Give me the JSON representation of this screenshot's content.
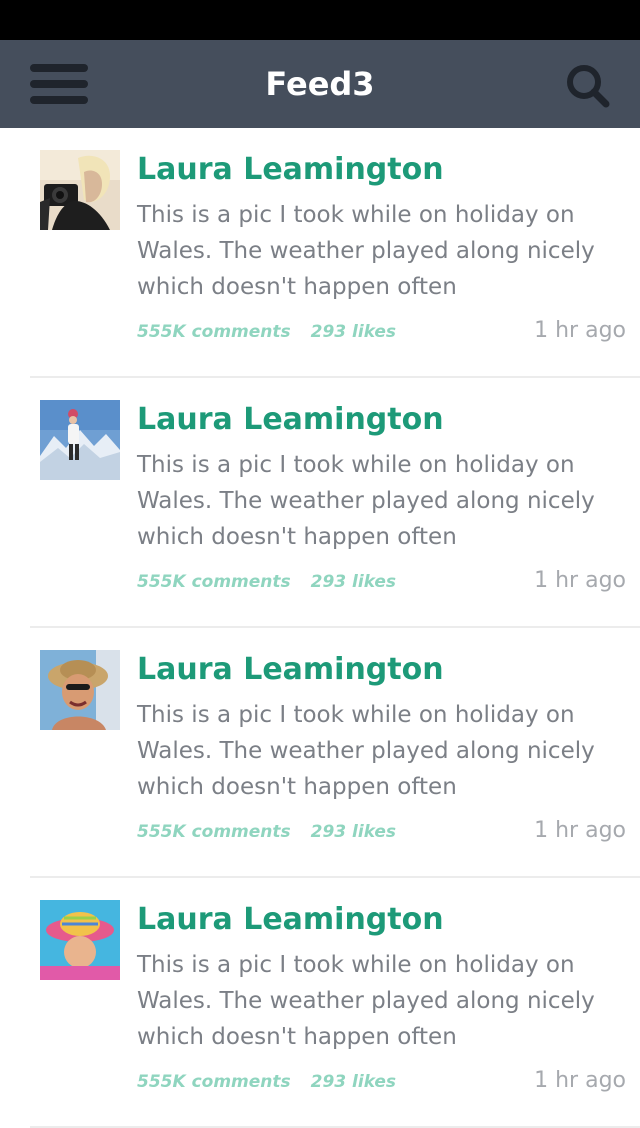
{
  "app": {
    "title": "Feed3"
  },
  "colors": {
    "nav_bg": "#454e5c",
    "accent": "#1d9a78",
    "meta": "#8fd5bf",
    "body_text": "#7b7f86",
    "time_text": "#a6a9ae"
  },
  "icons": {
    "menu": "hamburger-menu-icon",
    "search": "search-icon"
  },
  "posts": [
    {
      "author": "Laura Leamington",
      "text": "This is a pic I took while on holiday on Wales. The weather played along nicely which doesn't happen often",
      "comments": "555K comments",
      "likes": "293 likes",
      "time": "1 hr ago"
    },
    {
      "author": "Laura Leamington",
      "text": "This is a pic I took while on holiday on Wales. The weather played along nicely which doesn't happen often",
      "comments": "555K comments",
      "likes": "293 likes",
      "time": "1 hr ago"
    },
    {
      "author": "Laura Leamington",
      "text": "This is a pic I took while on holiday on Wales. The weather played along nicely which doesn't happen often",
      "comments": "555K comments",
      "likes": "293 likes",
      "time": "1 hr ago"
    },
    {
      "author": "Laura Leamington",
      "text": "This is a pic I took while on holiday on Wales. The weather played along nicely which doesn't happen often",
      "comments": "555K comments",
      "likes": "293 likes",
      "time": "1 hr ago"
    }
  ]
}
